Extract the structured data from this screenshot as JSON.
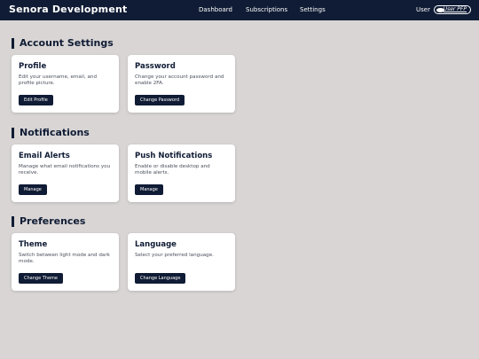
{
  "header": {
    "brand": "Senora Development",
    "nav": [
      "Dashboard",
      "Subscriptions",
      "Settings"
    ],
    "user_label": "User",
    "avatar_label": "User PFP"
  },
  "sections": [
    {
      "title": "Account Settings",
      "cards": [
        {
          "title": "Profile",
          "desc": "Edit your username, email, and profile picture.",
          "button": "Edit Profile"
        },
        {
          "title": "Password",
          "desc": "Change your account password and enable 2FA.",
          "button": "Change Password"
        }
      ]
    },
    {
      "title": "Notifications",
      "cards": [
        {
          "title": "Email Alerts",
          "desc": "Manage what email notifications you receive.",
          "button": "Manage"
        },
        {
          "title": "Push Notifications",
          "desc": "Enable or disable desktop and mobile alerts.",
          "button": "Manage"
        }
      ]
    },
    {
      "title": "Preferences",
      "cards": [
        {
          "title": "Theme",
          "desc": "Switch between light mode and dark mode.",
          "button": "Change Theme"
        },
        {
          "title": "Language",
          "desc": "Select your preferred language.",
          "button": "Change Language"
        }
      ]
    }
  ]
}
